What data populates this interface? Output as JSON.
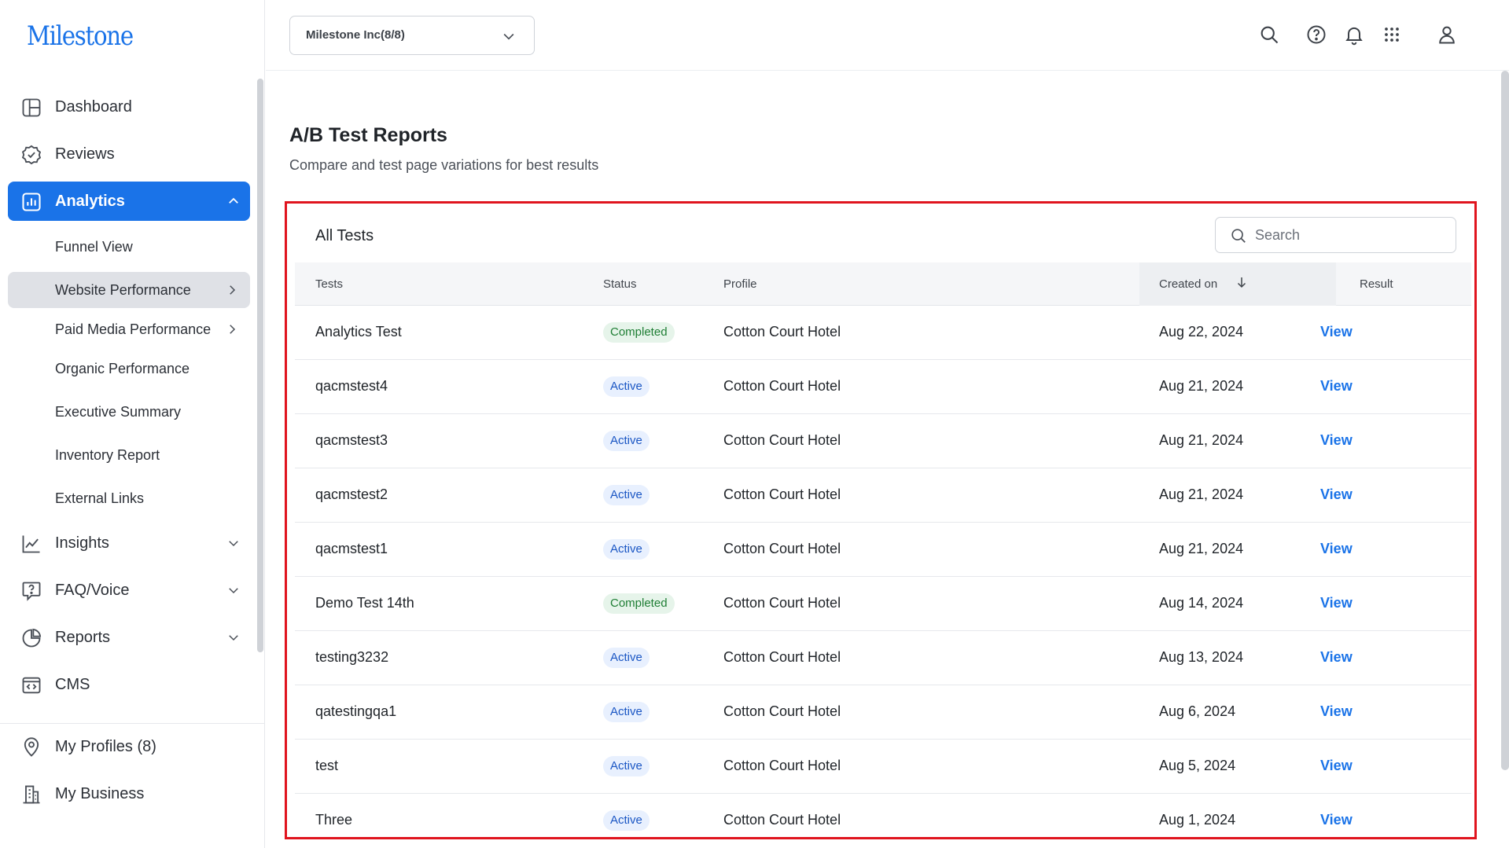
{
  "brand": {
    "logo_text": "Milestone",
    "accent": "#1a73e8"
  },
  "sidebar": {
    "items": [
      {
        "id": "dashboard",
        "label": "Dashboard",
        "icon": "dashboard-icon"
      },
      {
        "id": "reviews",
        "label": "Reviews",
        "icon": "check-badge-icon"
      },
      {
        "id": "analytics",
        "label": "Analytics",
        "icon": "bar-chart-icon",
        "active": true,
        "expanded": true
      },
      {
        "id": "insights",
        "label": "Insights",
        "icon": "line-chart-icon"
      },
      {
        "id": "faq",
        "label": "FAQ/Voice",
        "icon": "question-chat-icon"
      },
      {
        "id": "reports",
        "label": "Reports",
        "icon": "pie-chart-icon"
      },
      {
        "id": "cms",
        "label": "CMS",
        "icon": "code-window-icon"
      },
      {
        "id": "profiles",
        "label": "My Profiles (8)",
        "icon": "location-pin-icon"
      },
      {
        "id": "business",
        "label": "My Business",
        "icon": "building-icon"
      }
    ],
    "analytics_sub": [
      {
        "label": "Funnel View"
      },
      {
        "label": "Website Performance",
        "selected": true,
        "has_children": true
      },
      {
        "label": "Paid Media Performance",
        "has_children": true
      },
      {
        "label": "Organic Performance"
      },
      {
        "label": "Executive Summary"
      },
      {
        "label": "Inventory Report"
      },
      {
        "label": "External Links"
      }
    ]
  },
  "topbar": {
    "org_selector": "Milestone Inc(8/8)",
    "icons": [
      "search-icon",
      "help-icon",
      "bell-icon",
      "apps-grid-icon",
      "user-icon"
    ]
  },
  "page": {
    "title": "A/B Test Reports",
    "subtitle": "Compare and test page variations for best results"
  },
  "panel": {
    "title": "All Tests",
    "search_placeholder": "Search",
    "columns": {
      "tests": "Tests",
      "status": "Status",
      "profile": "Profile",
      "created": "Created on",
      "result": "Result"
    },
    "rows": [
      {
        "test": "Analytics Test",
        "status": "Completed",
        "profile": "Cotton Court Hotel",
        "created": "Aug 22, 2024",
        "result": "View"
      },
      {
        "test": "qacmstest4",
        "status": "Active",
        "profile": "Cotton Court Hotel",
        "created": "Aug 21, 2024",
        "result": "View"
      },
      {
        "test": "qacmstest3",
        "status": "Active",
        "profile": "Cotton Court Hotel",
        "created": "Aug 21, 2024",
        "result": "View"
      },
      {
        "test": "qacmstest2",
        "status": "Active",
        "profile": "Cotton Court Hotel",
        "created": "Aug 21, 2024",
        "result": "View"
      },
      {
        "test": "qacmstest1",
        "status": "Active",
        "profile": "Cotton Court Hotel",
        "created": "Aug 21, 2024",
        "result": "View"
      },
      {
        "test": "Demo Test 14th",
        "status": "Completed",
        "profile": "Cotton Court Hotel",
        "created": "Aug 14, 2024",
        "result": "View"
      },
      {
        "test": "testing3232",
        "status": "Active",
        "profile": "Cotton Court Hotel",
        "created": "Aug 13, 2024",
        "result": "View"
      },
      {
        "test": "qatestingqa1",
        "status": "Active",
        "profile": "Cotton Court Hotel",
        "created": "Aug 6, 2024",
        "result": "View"
      },
      {
        "test": "test",
        "status": "Active",
        "profile": "Cotton Court Hotel",
        "created": "Aug 5, 2024",
        "result": "View"
      },
      {
        "test": "Three",
        "status": "Active",
        "profile": "Cotton Court Hotel",
        "created": "Aug 1, 2024",
        "result": "View"
      }
    ]
  }
}
